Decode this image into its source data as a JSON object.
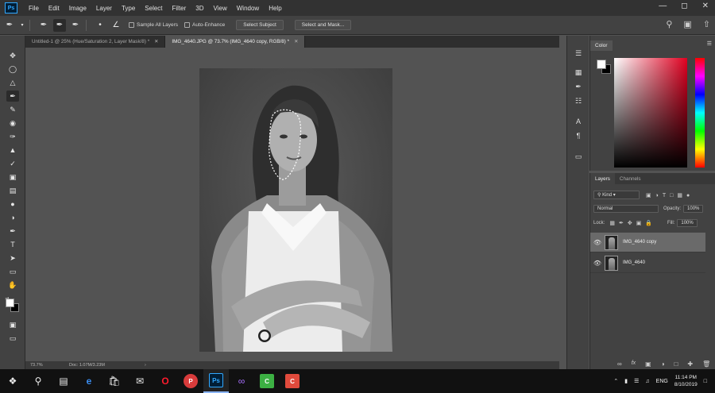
{
  "menu": [
    "File",
    "Edit",
    "Image",
    "Layer",
    "Type",
    "Select",
    "Filter",
    "3D",
    "View",
    "Window",
    "Help"
  ],
  "app_logo": "Ps",
  "options": {
    "sample_all_layers": "Sample All Layers",
    "auto_enhance": "Auto-Enhance",
    "select_subject": "Select Subject",
    "select_and_mask": "Select and Mask..."
  },
  "tabs": [
    {
      "label": "Untitled-1 @ 25% (Hue/Saturation 2, Layer Mask/8) *",
      "active": false
    },
    {
      "label": "IMG_4640.JPG @ 73.7% (IMG_4640 copy, RGB/8) *",
      "active": true
    }
  ],
  "status": {
    "zoom": "73.7%",
    "doc": "Doc: 1.07M/3.23M"
  },
  "color_panel": {
    "title": "Color"
  },
  "layers_panel": {
    "tabs": [
      "Layers",
      "Channels"
    ],
    "filter_kind": "Kind",
    "blend_mode": "Normal",
    "opacity_label": "Opacity:",
    "opacity": "100%",
    "lock_label": "Lock:",
    "fill_label": "Fill:",
    "fill": "100%",
    "layers": [
      {
        "name": "IMG_4640 copy",
        "selected": true
      },
      {
        "name": "IMG_4640",
        "selected": false
      }
    ]
  },
  "taskbar": {
    "lang": "ENG",
    "time": "11:14 PM",
    "date": "8/10/2019"
  }
}
